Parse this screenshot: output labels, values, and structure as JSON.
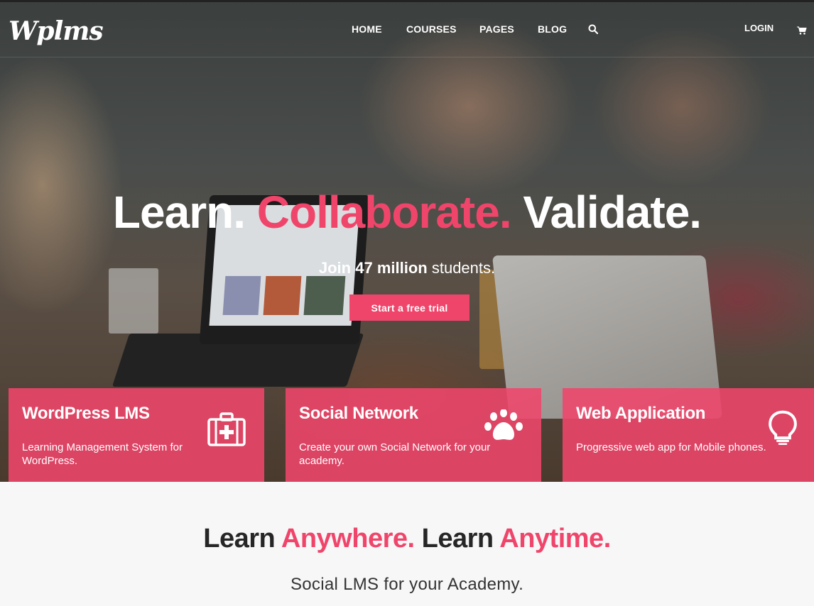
{
  "header": {
    "logo": "Wplms",
    "nav": [
      "HOME",
      "COURSES",
      "PAGES",
      "BLOG"
    ],
    "login": "LOGIN"
  },
  "hero": {
    "title_part1": "Learn.",
    "title_part2": "Collaborate.",
    "title_part3": "Validate.",
    "subtitle_prefix": "Join",
    "subtitle_highlight": "47 million",
    "subtitle_suffix": "students.",
    "cta": "Start a free trial",
    "accent_color": "#f0456b"
  },
  "features": [
    {
      "title": "WordPress LMS",
      "desc": "Learning Management System for WordPress.",
      "icon": "medkit-icon"
    },
    {
      "title": "Social Network",
      "desc": "Create your own Social Network for your academy.",
      "icon": "paw-icon"
    },
    {
      "title": "Web Application",
      "desc": "Progressive web app for Mobile phones.",
      "icon": "lightbulb-icon"
    }
  ],
  "section": {
    "h_part1": "Learn",
    "h_part2": "Anywhere.",
    "h_part3": "Learn",
    "h_part4": "Anytime.",
    "subheading": "Social LMS for your Academy."
  }
}
